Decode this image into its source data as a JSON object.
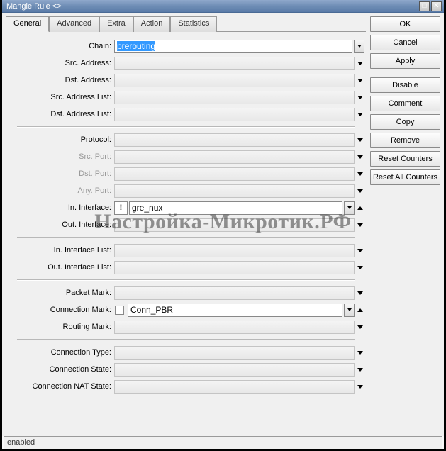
{
  "window": {
    "title": "Mangle Rule <>"
  },
  "tabs": [
    "General",
    "Advanced",
    "Extra",
    "Action",
    "Statistics"
  ],
  "active_tab": 0,
  "buttons": {
    "ok": "OK",
    "cancel": "Cancel",
    "apply": "Apply",
    "disable": "Disable",
    "comment": "Comment",
    "copy": "Copy",
    "remove": "Remove",
    "reset_counters": "Reset Counters",
    "reset_all_counters": "Reset All Counters"
  },
  "fields": {
    "chain": {
      "label": "Chain:",
      "value": "prerouting",
      "selected": true
    },
    "src_address": {
      "label": "Src. Address:",
      "value": ""
    },
    "dst_address": {
      "label": "Dst. Address:",
      "value": ""
    },
    "src_address_list": {
      "label": "Src. Address List:",
      "value": ""
    },
    "dst_address_list": {
      "label": "Dst. Address List:",
      "value": ""
    },
    "protocol": {
      "label": "Protocol:",
      "value": ""
    },
    "src_port": {
      "label": "Src. Port:",
      "value": "",
      "disabled": true
    },
    "dst_port": {
      "label": "Dst. Port:",
      "value": "",
      "disabled": true
    },
    "any_port": {
      "label": "Any. Port:",
      "value": "",
      "disabled": true
    },
    "in_interface": {
      "label": "In. Interface:",
      "value": "gre_nux",
      "not": "!"
    },
    "out_interface": {
      "label": "Out. Interface:",
      "value": ""
    },
    "in_interface_list": {
      "label": "In. Interface List:",
      "value": ""
    },
    "out_interface_list": {
      "label": "Out. Interface List:",
      "value": ""
    },
    "packet_mark": {
      "label": "Packet Mark:",
      "value": ""
    },
    "connection_mark": {
      "label": "Connection Mark:",
      "value": "Conn_PBR",
      "checked": false
    },
    "routing_mark": {
      "label": "Routing Mark:",
      "value": ""
    },
    "connection_type": {
      "label": "Connection Type:",
      "value": ""
    },
    "connection_state": {
      "label": "Connection State:",
      "value": ""
    },
    "connection_nat_state": {
      "label": "Connection NAT State:",
      "value": ""
    }
  },
  "status": "enabled",
  "watermark": "Настройка-Микротик.РФ"
}
